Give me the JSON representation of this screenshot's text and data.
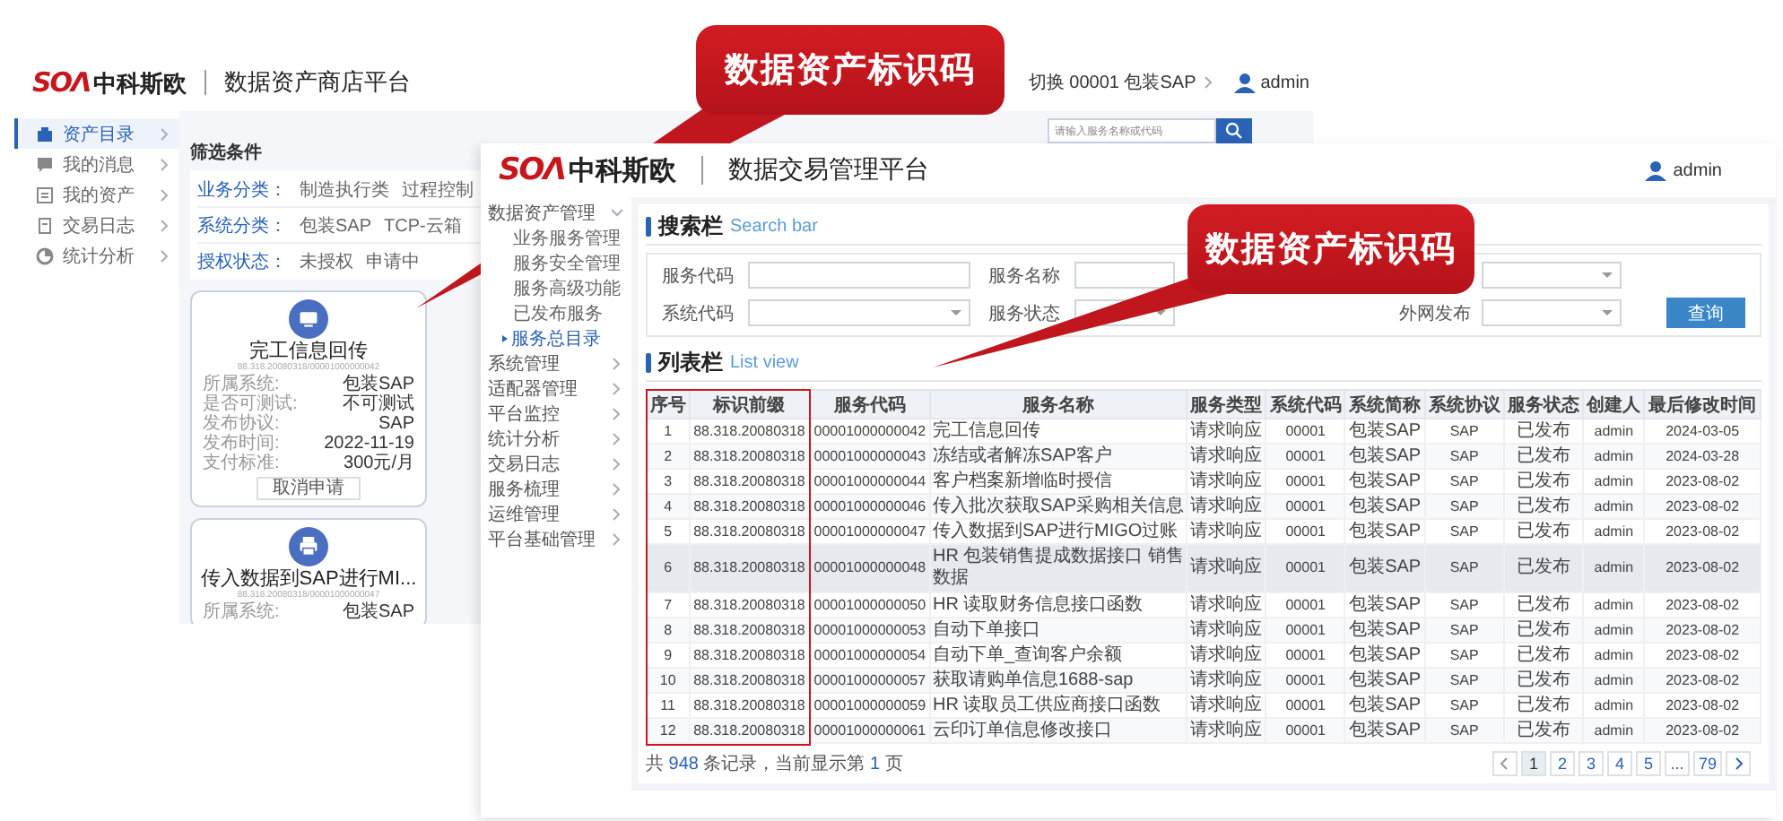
{
  "store_window": {
    "logo": "SOΛ",
    "logo_name": "中科斯欧",
    "title": "数据资产商店平台",
    "system_switch": "切换 00001 包装SAP",
    "user": "admin",
    "search": {
      "placeholder": "请输入服务名称或代码"
    },
    "nav": [
      {
        "label": "资产目录",
        "selected": true
      },
      {
        "label": "我的消息",
        "selected": false
      },
      {
        "label": "我的资产",
        "selected": false
      },
      {
        "label": "交易日志",
        "selected": false
      },
      {
        "label": "统计分析",
        "selected": false
      }
    ],
    "filter_title": "筛选条件",
    "filters": [
      {
        "label": "业务分类：",
        "options": [
          "制造执行类",
          "过程控制"
        ]
      },
      {
        "label": "系统分类：",
        "options": [
          "包装SAP",
          "TCP-云箱"
        ]
      },
      {
        "label": "授权状态：",
        "options": [
          "未授权",
          "申请中"
        ]
      }
    ],
    "cards": [
      {
        "kind": "monitor",
        "title": "完工信息回传",
        "code": "88.318.20080318/00001000000042",
        "fields": [
          {
            "label": "所属系统:",
            "value": "包装SAP"
          },
          {
            "label": "是否可测试:",
            "value": "不可测试"
          },
          {
            "label": "发布协议:",
            "value": "SAP"
          },
          {
            "label": "发布时间:",
            "value": "2022-11-19"
          },
          {
            "label": "支付标准:",
            "value": "300元/月"
          }
        ],
        "action": "取消申请"
      },
      {
        "kind": "printer",
        "title": "传入数据到SAP进行MI...",
        "code": "88.318.20080318/00001000000047",
        "fields": [
          {
            "label": "所属系统:",
            "value": "包装SAP"
          }
        ]
      }
    ]
  },
  "admin_window": {
    "logo": "SOΛ",
    "logo_name": "中科斯欧",
    "title": "数据交易管理平台",
    "user": "admin",
    "nav": [
      {
        "label": "数据资产管理",
        "expanded": true,
        "children": [
          {
            "label": "业务服务管理",
            "expanded": false,
            "selected": false
          },
          {
            "label": "服务安全管理",
            "expanded": false,
            "selected": false
          },
          {
            "label": "服务高级功能",
            "expanded": false,
            "selected": false
          },
          {
            "label": "已发布服务",
            "selected": false
          },
          {
            "label": "服务总目录",
            "selected": true
          }
        ]
      },
      {
        "label": "系统管理",
        "expanded": false
      },
      {
        "label": "适配器管理",
        "expanded": false
      },
      {
        "label": "平台监控",
        "expanded": false
      },
      {
        "label": "统计分析",
        "expanded": false
      },
      {
        "label": "交易日志",
        "expanded": false
      },
      {
        "label": "服务梳理",
        "expanded": false
      },
      {
        "label": "运维管理",
        "expanded": false
      },
      {
        "label": "平台基础管理",
        "expanded": false
      }
    ],
    "search_bar": {
      "title": "搜索栏",
      "subtitle": "Search bar",
      "fields": [
        {
          "label": "服务代码",
          "kind": "input"
        },
        {
          "label": "服务名称",
          "kind": "input"
        },
        {
          "kind": "select"
        },
        {
          "label": "系统代码",
          "kind": "select"
        },
        {
          "label": "服务状态",
          "kind": "select"
        },
        {
          "label": "外网发布",
          "kind": "select"
        }
      ],
      "button": "查询"
    },
    "list": {
      "title": "列表栏",
      "subtitle": "List view",
      "columns": [
        "序号",
        "标识前缀",
        "服务代码",
        "服务名称",
        "服务类型",
        "系统代码",
        "系统简称",
        "系统协议",
        "服务状态",
        "创建人",
        "最后修改时间"
      ],
      "rows": [
        {
          "hovered": false,
          "cells": [
            "1",
            "88.318.20080318",
            "00001000000042",
            "完工信息回传",
            "请求响应",
            "00001",
            "包装SAP",
            "SAP",
            "已发布",
            "admin",
            "2024-03-05"
          ]
        },
        {
          "hovered": false,
          "cells": [
            "2",
            "88.318.20080318",
            "00001000000043",
            "冻结或者解冻SAP客户",
            "请求响应",
            "00001",
            "包装SAP",
            "SAP",
            "已发布",
            "admin",
            "2024-03-28"
          ]
        },
        {
          "hovered": false,
          "cells": [
            "3",
            "88.318.20080318",
            "00001000000044",
            "客户档案新增临时授信",
            "请求响应",
            "00001",
            "包装SAP",
            "SAP",
            "已发布",
            "admin",
            "2023-08-02"
          ]
        },
        {
          "hovered": false,
          "cells": [
            "4",
            "88.318.20080318",
            "00001000000046",
            "传入批次获取SAP采购相关信息",
            "请求响应",
            "00001",
            "包装SAP",
            "SAP",
            "已发布",
            "admin",
            "2023-08-02"
          ]
        },
        {
          "hovered": false,
          "cells": [
            "5",
            "88.318.20080318",
            "00001000000047",
            "传入数据到SAP进行MIGO过账",
            "请求响应",
            "00001",
            "包装SAP",
            "SAP",
            "已发布",
            "admin",
            "2023-08-02"
          ]
        },
        {
          "hovered": true,
          "cells": [
            "6",
            "88.318.20080318",
            "00001000000048",
            "HR 包装销售提成数据接口 销售数据",
            "请求响应",
            "00001",
            "包装SAP",
            "SAP",
            "已发布",
            "admin",
            "2023-08-02"
          ]
        },
        {
          "hovered": false,
          "cells": [
            "7",
            "88.318.20080318",
            "00001000000050",
            "HR 读取财务信息接口函数",
            "请求响应",
            "00001",
            "包装SAP",
            "SAP",
            "已发布",
            "admin",
            "2023-08-02"
          ]
        },
        {
          "hovered": false,
          "cells": [
            "8",
            "88.318.20080318",
            "00001000000053",
            "自动下单接口",
            "请求响应",
            "00001",
            "包装SAP",
            "SAP",
            "已发布",
            "admin",
            "2023-08-02"
          ]
        },
        {
          "hovered": false,
          "cells": [
            "9",
            "88.318.20080318",
            "00001000000054",
            "自动下单_查询客户余额",
            "请求响应",
            "00001",
            "包装SAP",
            "SAP",
            "已发布",
            "admin",
            "2023-08-02"
          ]
        },
        {
          "hovered": false,
          "cells": [
            "10",
            "88.318.20080318",
            "00001000000057",
            "获取请购单信息1688-sap",
            "请求响应",
            "00001",
            "包装SAP",
            "SAP",
            "已发布",
            "admin",
            "2023-08-02"
          ]
        },
        {
          "hovered": false,
          "cells": [
            "11",
            "88.318.20080318",
            "00001000000059",
            "HR 读取员工供应商接口函数",
            "请求响应",
            "00001",
            "包装SAP",
            "SAP",
            "已发布",
            "admin",
            "2023-08-02"
          ]
        },
        {
          "hovered": false,
          "cells": [
            "12",
            "88.318.20080318",
            "00001000000061",
            "云印订单信息修改接口",
            "请求响应",
            "00001",
            "包装SAP",
            "SAP",
            "已发布",
            "admin",
            "2023-08-02"
          ]
        }
      ],
      "summary": {
        "before": "共 ",
        "total": "948",
        "middle": " 条记录，当前显示第 ",
        "page": "1",
        "after": " 页"
      },
      "pages": [
        {
          "label": "1",
          "selected": true
        },
        {
          "label": "2",
          "selected": false
        },
        {
          "label": "3",
          "selected": false
        },
        {
          "label": "4",
          "selected": false
        },
        {
          "label": "5",
          "selected": false
        },
        {
          "label": "...",
          "selected": false
        },
        {
          "label": "79",
          "selected": false
        }
      ]
    }
  },
  "callouts": [
    {
      "text": "数据资产标识码"
    },
    {
      "text": "数据资产标识码"
    }
  ]
}
